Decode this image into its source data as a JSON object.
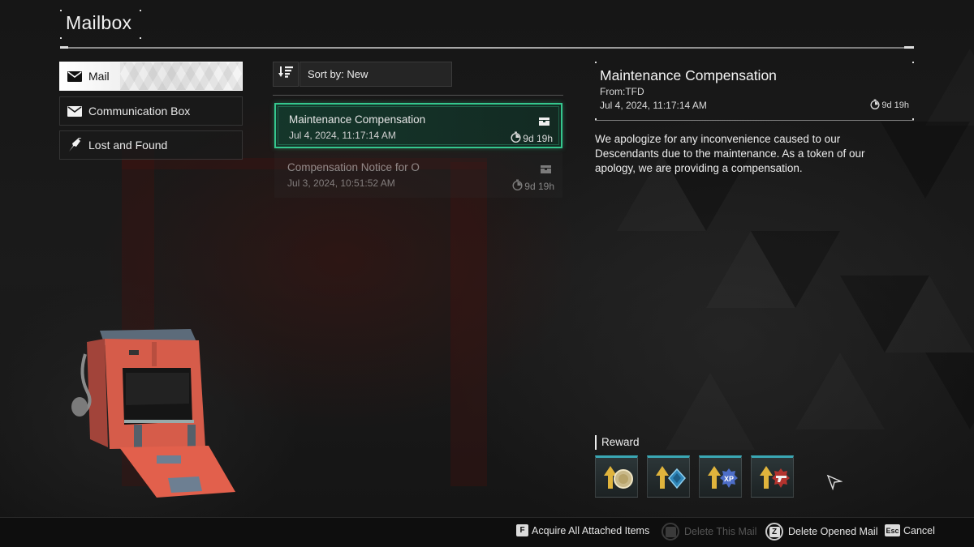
{
  "header": {
    "title": "Mailbox"
  },
  "sidebar": {
    "tabs": [
      {
        "label": "Mail",
        "icon": "envelope-icon",
        "active": true
      },
      {
        "label": "Communication Box",
        "icon": "envelope-icon",
        "active": false
      },
      {
        "label": "Lost and Found",
        "icon": "umbrella-icon",
        "active": false
      }
    ]
  },
  "sort": {
    "icon": "sort-descending-icon",
    "label": "Sort by: New"
  },
  "mail_list": [
    {
      "subject": "Maintenance Compensation",
      "date": "Jul 4, 2024, 11:17:14 AM",
      "remaining": "9d 19h",
      "selected": true
    },
    {
      "subject": "Compensation Notice for O",
      "date": "Jul 3, 2024, 10:51:52 AM",
      "remaining": "9d 19h",
      "selected": false
    }
  ],
  "detail": {
    "title": "Maintenance Compensation",
    "from": "From:TFD",
    "date": "Jul 4, 2024, 11:17:14 AM",
    "remaining": "9d 19h",
    "body": "We apologize for any inconvenience caused to our Descendants due to the maintenance. As a token of our apology, we are providing a compensation."
  },
  "rewards": {
    "label": "Reward",
    "items": [
      {
        "name": "gold-boost-icon"
      },
      {
        "name": "kuiper-boost-icon"
      },
      {
        "name": "xp-boost-icon"
      },
      {
        "name": "weapon-xp-boost-icon"
      }
    ]
  },
  "hints": [
    {
      "key": "F",
      "label": "Acquire All Attached Items",
      "enabled": true
    },
    {
      "key": "",
      "label": "Delete This Mail",
      "enabled": false
    },
    {
      "key": "Z",
      "label": "Delete Opened Mail",
      "enabled": true
    },
    {
      "key": "Esc",
      "label": "Cancel",
      "enabled": true
    }
  ],
  "colors": {
    "accent": "#35c78e",
    "reward_top": "#3aa7b4"
  }
}
